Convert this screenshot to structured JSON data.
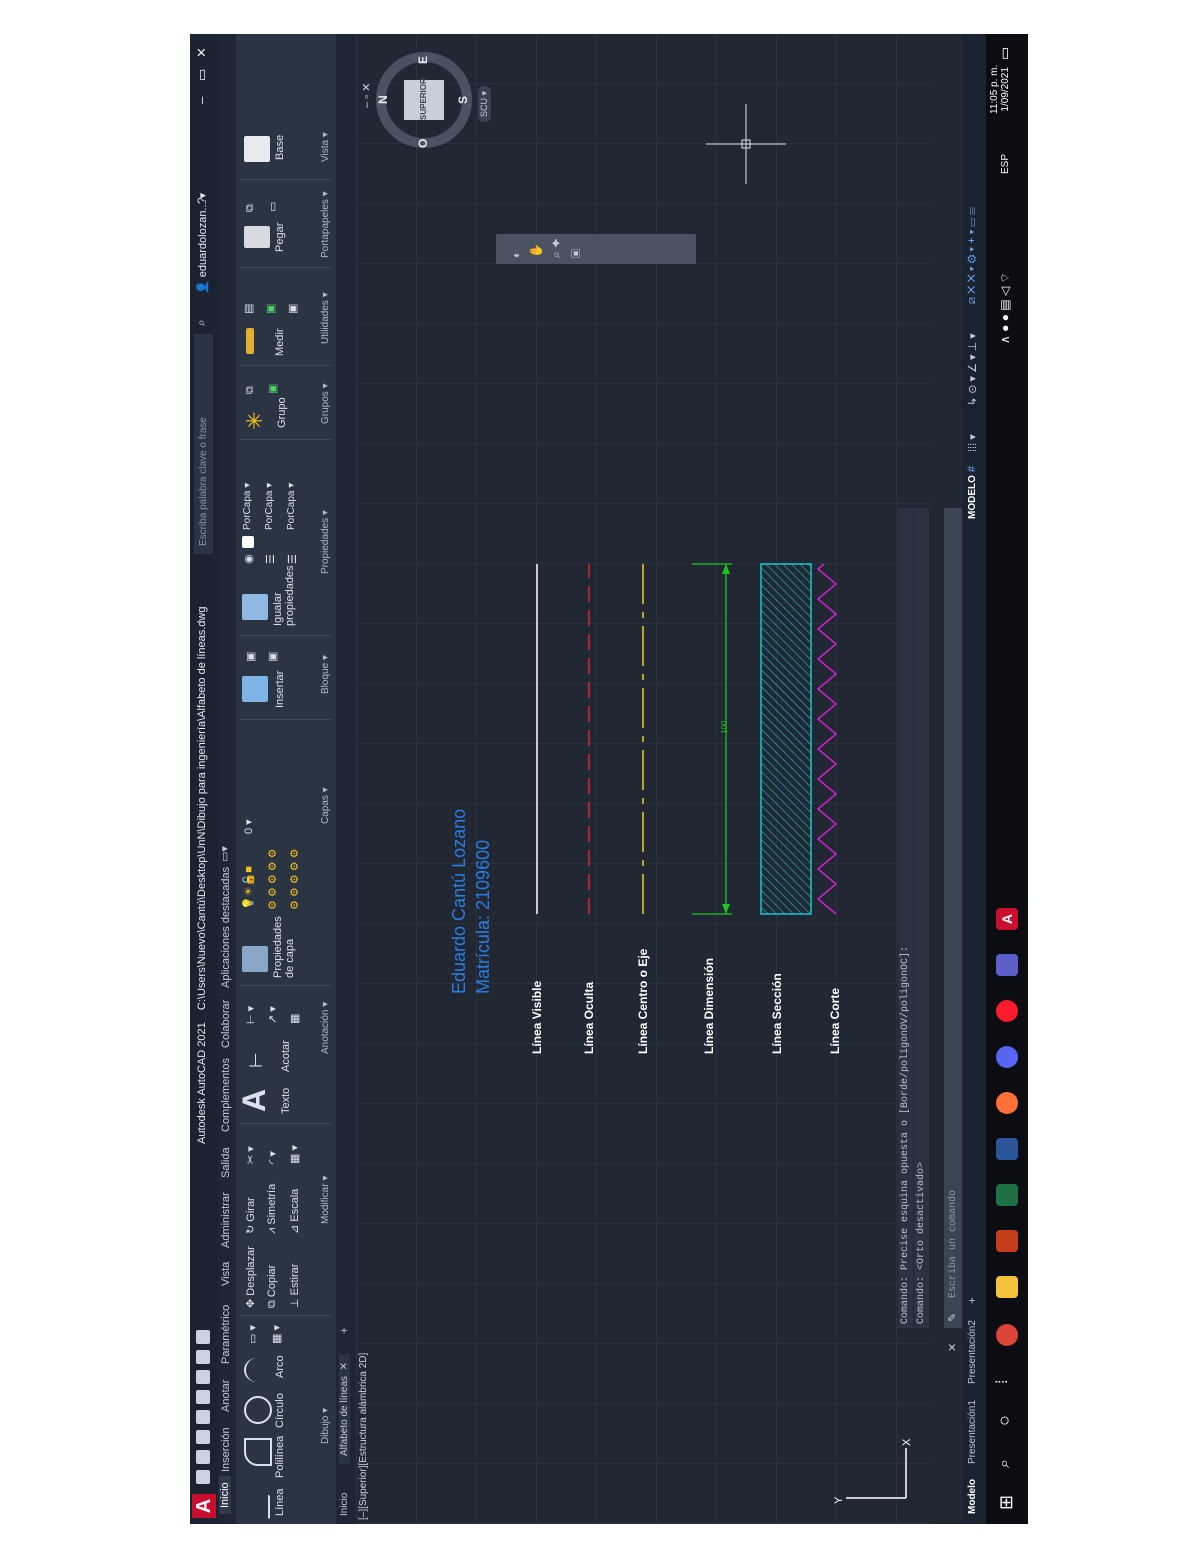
{
  "titlebar": {
    "app_title": "Autodesk AutoCAD 2021",
    "file_path": "C:\\Users\\Nuevo\\Cantú\\Desktop\\UnN\\Dibujo para ingeniería\\Alfabeto de líneas.dwg",
    "search_placeholder": "Escriba palabra clave o frase",
    "user": "eduardolozan..."
  },
  "ribbon_tabs": [
    "Inicio",
    "Inserción",
    "Anotar",
    "Paramétrico",
    "Vista",
    "Administrar",
    "Salida",
    "Complementos",
    "Colaborar",
    "Aplicaciones destacadas"
  ],
  "ribbon": {
    "dibujo": {
      "linea": "Línea",
      "polilinea": "Polilínea",
      "circulo": "Círculo",
      "arco": "Arco",
      "panel": "Dibujo ▾"
    },
    "modificar": {
      "desplazar": "Desplazar",
      "girar": "Girar",
      "copiar": "Copiar",
      "simetria": "Simetría",
      "estirar": "Estirar",
      "escala": "Escala",
      "panel": "Modificar ▾"
    },
    "anotacion": {
      "texto": "Texto",
      "acotar": "Acotar",
      "panel": "Anotación ▾"
    },
    "capas": {
      "propiedades": "Propiedades de capa",
      "current": "0",
      "panel": "Capas ▾"
    },
    "bloque": {
      "insertar": "Insertar",
      "panel": "Bloque ▾"
    },
    "propiedades": {
      "igualar": "Igualar propiedades",
      "por_capa_1": "PorCapa",
      "por_capa_2": "PorCapa",
      "por_capa_3": "PorCapa",
      "panel": "Propiedades ▾"
    },
    "grupos": {
      "grupo": "Grupo",
      "panel": "Grupos ▾"
    },
    "utilidades": {
      "medir": "Medir",
      "panel": "Utilidades ▾"
    },
    "portapapeles": {
      "pegar": "Pegar",
      "panel": "Portapapeles ▾"
    },
    "vista": {
      "base": "Base",
      "panel": "Vista ▾"
    }
  },
  "file_tabs": {
    "inicio": "Inicio",
    "active": "Alfabeto de líneas",
    "close": "✕",
    "add": "+"
  },
  "viewport": {
    "label": "[–][Superior][Estructura alámbrica 2D]"
  },
  "viewcube": {
    "face": "SUPERIOR",
    "n": "N",
    "s": "S",
    "e": "E",
    "o": "O",
    "scu": "SCU ▾"
  },
  "drawing": {
    "name": "Eduardo Cantú Lozano",
    "matricula": "Matrícula: 2109600",
    "dimension_value": "100",
    "line_types": [
      {
        "label": "Línea Visible",
        "color": "#ffffff",
        "style": "solid"
      },
      {
        "label": "Línea Oculta",
        "color": "#d9262b",
        "style": "dashed"
      },
      {
        "label": "Línea Centro o Eje",
        "color": "#e8d31e",
        "style": "center"
      },
      {
        "label": "Línea Dimensión",
        "color": "#1fc41f",
        "style": "dimension"
      },
      {
        "label": "Línea Sección",
        "color": "#19c7c9",
        "style": "hatch"
      },
      {
        "label": "Línea Corte",
        "color": "#d21fcf",
        "style": "zigzag"
      }
    ]
  },
  "command": {
    "history_1": "Comando: Precise esquina opuesta o [Borde/polígonOV/poligonOC]:",
    "history_2": "Comando: <Orto desactivado>",
    "input_placeholder": "Escriba un comando"
  },
  "layout_tabs": {
    "modelo": "Modelo",
    "p1": "Presentación1",
    "p2": "Presentación2",
    "add": "+"
  },
  "status": {
    "mode": "MODELO"
  },
  "taskbar": {
    "time": "11:05 p. m.",
    "date": "1/09/2021",
    "lang": "ESP"
  }
}
